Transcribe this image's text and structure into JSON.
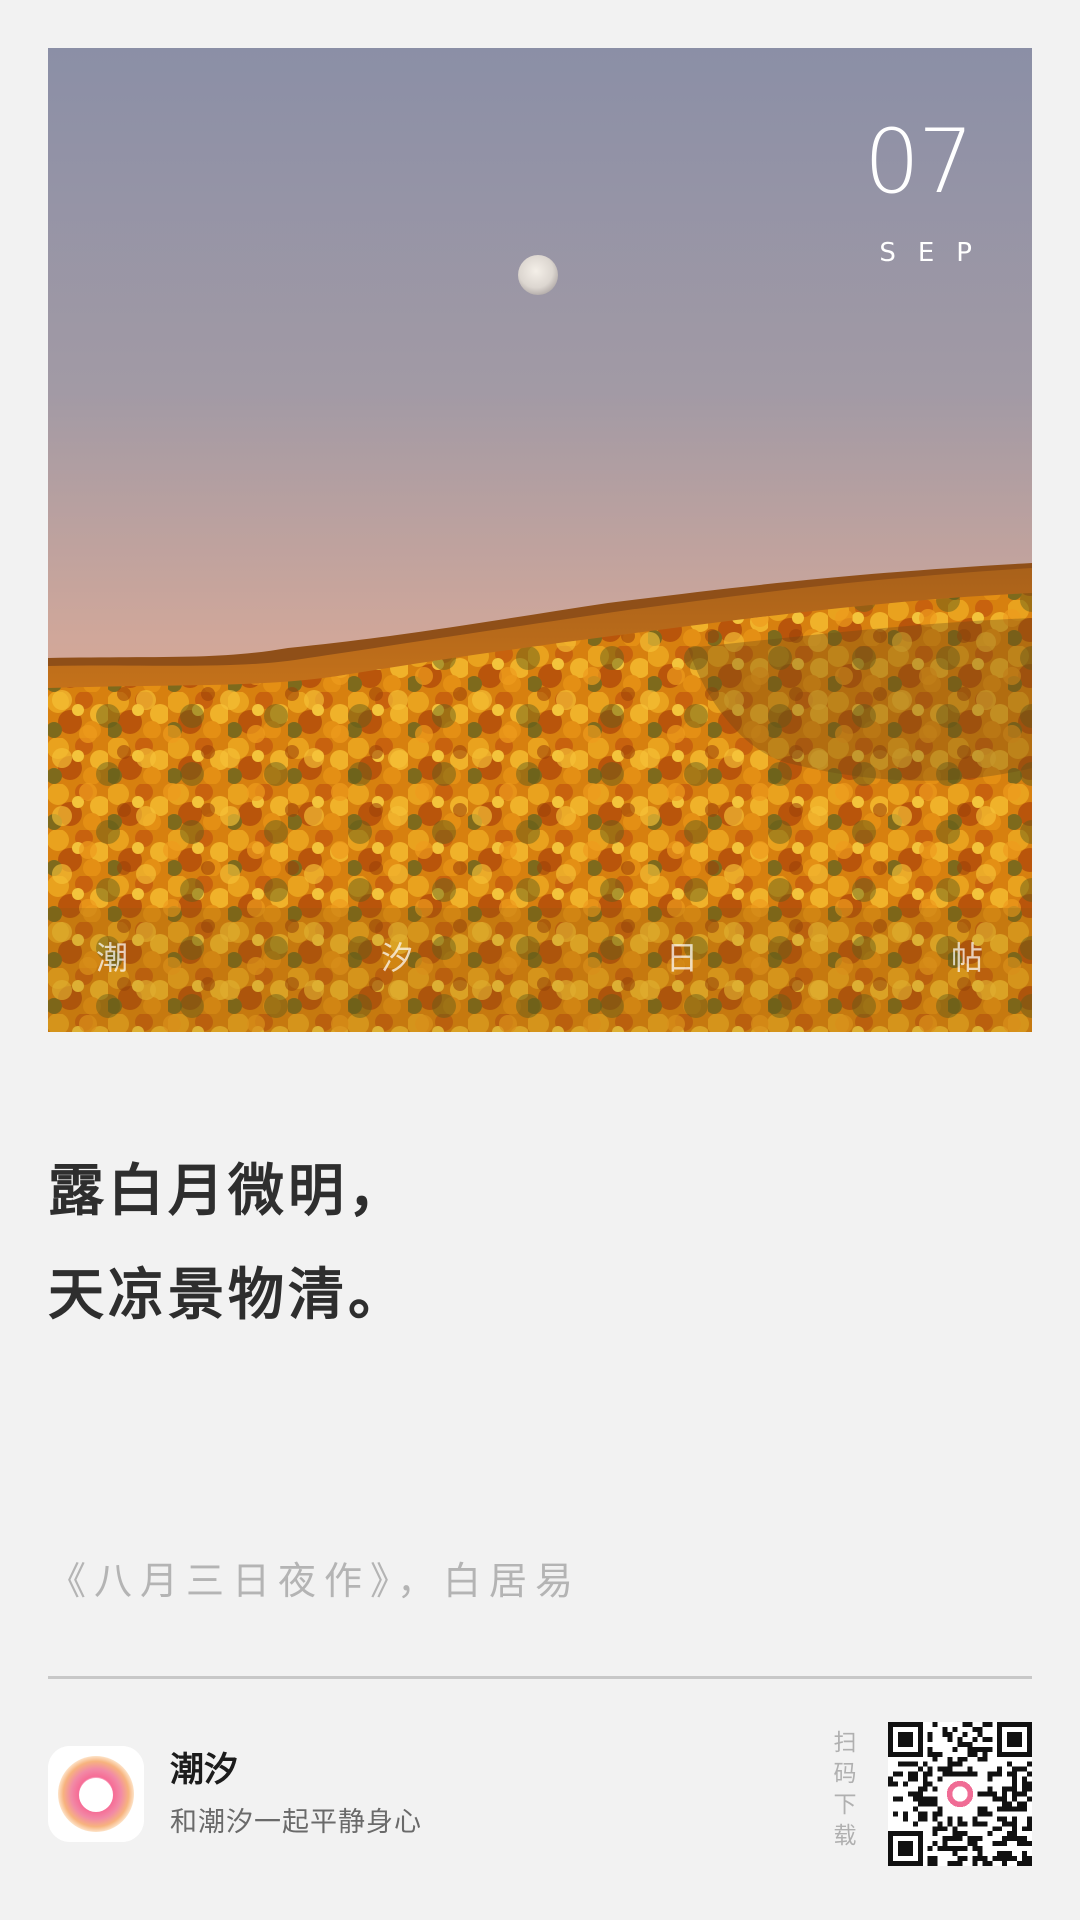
{
  "card": {
    "day": "07",
    "month": "SEP",
    "watermark": [
      "潮",
      "汐",
      "日",
      "帖"
    ]
  },
  "poem": {
    "lines": [
      "露白月微明，",
      "天凉景物清。"
    ],
    "source": "《八月三日夜作》，白居易"
  },
  "footer": {
    "app_name": "潮汐",
    "slogan": "和潮汐一起平静身心",
    "scan_label": "扫码下载"
  },
  "colors": {
    "background": "#f2f2f2",
    "sky_top": "#8d90a6",
    "sky_bottom": "#d9a590",
    "foliage": "#d9810f",
    "text_dark": "#2e2e2e",
    "text_muted": "#b4b4b4",
    "icon_ring": "#ef5f88"
  },
  "icons": {
    "app": "tide-ring-icon",
    "qr": "qr-code"
  }
}
